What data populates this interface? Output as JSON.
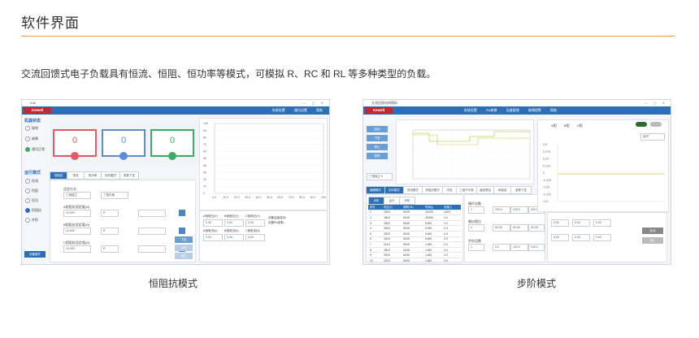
{
  "page": {
    "heading": "软件界面",
    "description": "交流回馈式电子负载具有恒流、恒阻、恒功率等模式，可模拟 R、RC 和 RL 等多种类型的负载。",
    "accent": "#e3a23b",
    "brand_blue": "#2d6fb7",
    "brand_red": "#c8262d"
  },
  "left_shot": {
    "caption": "恒阻抗模式",
    "title": "Kdk",
    "logo": "Kewell",
    "menu": [
      "系统设置",
      "通讯设置",
      "帮助"
    ],
    "section1": "机器状态",
    "status_items": [
      "接地",
      "故障",
      "通讯正常"
    ],
    "section2": "运行模式",
    "mode_items": [
      "恒流",
      "恒阻",
      "恒功",
      "恒阻抗",
      "步阶"
    ],
    "gauges": [
      {
        "value": "0",
        "letter": "A",
        "color": "#e35a62"
      },
      {
        "value": "0",
        "letter": "B",
        "color": "#5b8ed6"
      },
      {
        "value": "0",
        "letter": "C",
        "color": "#3daa62"
      }
    ],
    "tabs": [
      "恒阻抗",
      "恒流",
      "恒功率",
      "步阶模式",
      "参数下发"
    ],
    "fields": [
      {
        "label": "设定方式",
        "value": "三相独立"
      },
      {
        "label": "",
        "value": "三相平衡"
      },
      {
        "label": "A相阻抗设定值(Ω)",
        "value": "10.000"
      },
      {
        "label": "B相阻抗设定值(Ω)",
        "value": "10.000"
      },
      {
        "label": "C相阻抗设定值(Ω)",
        "value": "10.000"
      }
    ],
    "buttons": [
      "下发",
      "启动",
      "停止"
    ],
    "readouts": [
      "A相电压(V)",
      "B相电压(V)",
      "C相电压(V)",
      "A相电流(A)",
      "B相电流(A)",
      "C相电流(A)"
    ],
    "readout_value": "0.00",
    "notes": [
      "设备连接成功!",
      "设置Pid参数..."
    ],
    "footer_btn": "设备断开",
    "chart_y_ticks": [
      "100",
      "90",
      "80",
      "70",
      "60",
      "50",
      "40",
      "30",
      "20",
      "10",
      "0"
    ],
    "chart_x_ticks": [
      "0.0",
      "10.0",
      "20.0",
      "30.0",
      "40.0",
      "50.0",
      "60.0",
      "70.0",
      "80.0",
      "90.0",
      "100.0"
    ]
  },
  "right_shot": {
    "caption": "步阶模式",
    "title": "交流回馈电网模拟",
    "menu": [
      "系统设置",
      "Pid参数",
      "设备管理",
      "故障报警",
      "帮助"
    ],
    "side_buttons": [
      "启动",
      "下发",
      "停止",
      "暂停"
    ],
    "tabs": [
      "编辑模式",
      "步阶模式",
      "恒流模式",
      "恒阻抗模式",
      "闪变",
      "三相不平衡",
      "谐波叠加",
      "间谐波",
      "参数下发"
    ],
    "sub_tabs": [
      "步阶",
      "运行",
      "步阶"
    ],
    "table_headers": [
      "序号",
      "电压(V)",
      "频率(Hz)",
      "时间(s)",
      "相角(°)"
    ],
    "table_rows": [
      [
        "1",
        "220.0",
        "50.00",
        "10.000",
        "120.0"
      ],
      [
        "2",
        "180.0",
        "50.00",
        "25.000",
        "0.0"
      ],
      [
        "3",
        "230.0",
        "50.00",
        "5.000",
        "0.0"
      ],
      [
        "4",
        "200.0",
        "50.00",
        "5.000",
        "0.0"
      ],
      [
        "5",
        "220.0",
        "50.00",
        "5.000",
        "0.0"
      ],
      [
        "6",
        "240.0",
        "50.00",
        "5.000",
        "0.0"
      ],
      [
        "7",
        "210.0",
        "50.00",
        "1.000",
        "0.0"
      ],
      [
        "8",
        "190.0",
        "40.00",
        "1.000",
        "0.0"
      ],
      [
        "9",
        "200.0",
        "60.00",
        "1.000",
        "0.0"
      ],
      [
        "10",
        "220.0",
        "50.00",
        "1.000",
        "0.0"
      ]
    ],
    "form_labels": [
      "循环次数",
      "输出相位",
      "步阶总数"
    ],
    "right_legend": [
      "A相",
      "B相",
      "C相"
    ],
    "right_y_ticks": [
      "0.5",
      "0.375",
      "0.25",
      "0.125",
      "0",
      "-0.125",
      "-0.25",
      "-0.375",
      "-0.5"
    ],
    "buttons": [
      "启动",
      "停止"
    ],
    "dropdown": "实时"
  }
}
